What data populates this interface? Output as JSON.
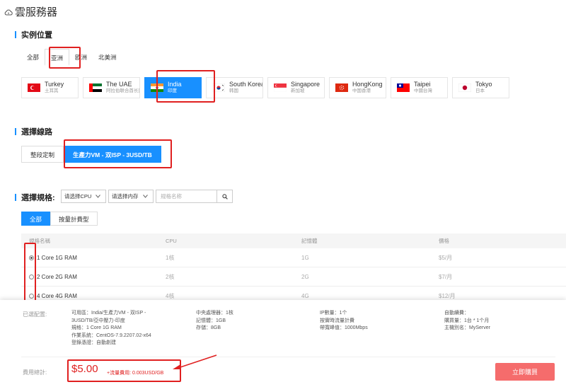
{
  "header": {
    "title": "雲服務器"
  },
  "sections": {
    "location": "实例位置",
    "line": "選擇線路",
    "spec": "選擇規格:"
  },
  "region_tabs": [
    "全部",
    "亚洲",
    "欧洲",
    "北美洲"
  ],
  "regions": [
    {
      "name": "Turkey",
      "sub": "土耳其"
    },
    {
      "name": "The UAE",
      "sub": "阿拉伯联合酋长国"
    },
    {
      "name": "India",
      "sub": "印度"
    },
    {
      "name": "South Korea",
      "sub": "韩国"
    },
    {
      "name": "Singapore",
      "sub": "新加坡"
    },
    {
      "name": "HongKong",
      "sub": "中国香港"
    },
    {
      "name": "Taipei",
      "sub": "中國台灣"
    },
    {
      "name": "Tokyo",
      "sub": "日本"
    }
  ],
  "line_tabs": [
    "整段定制",
    "生產力VM - 双ISP - 3USD/TB"
  ],
  "filters": {
    "cpu": "请选择CPU",
    "memory": "请选择内存",
    "search_placeholder": "规格名称"
  },
  "type_tabs": [
    "全部",
    "按量計費型"
  ],
  "table": {
    "headers": [
      "規格名稱",
      "CPU",
      "記憶體",
      "價格"
    ],
    "rows": [
      {
        "name": "1 Core 1G RAM",
        "cpu": "1核",
        "mem": "1G",
        "price": "$5/月"
      },
      {
        "name": "2 Core 2G RAM",
        "cpu": "2核",
        "mem": "2G",
        "price": "$7/月"
      },
      {
        "name": "4 Core 4G RAM",
        "cpu": "4核",
        "mem": "4G",
        "price": "$12/月"
      }
    ]
  },
  "footer": {
    "selected_label": "已選配置:",
    "col1": [
      "可用區：India/生產力VM - 双ISP -",
      "3USD/TB/亞中壓力-印度",
      "規格：1 Core 1G RAM",
      "作業系統：CentOS-7.9.2207.02-x64",
      "登錄憑證：自動創建"
    ],
    "col2": [
      "中央處理器：1核",
      "記憶體：1GB",
      "存儲：8GB"
    ],
    "col3": [
      "IP數量：1个",
      "按實時流量計費",
      "帶寬峰值：1000Mbps"
    ],
    "col4": [
      "自動續費：",
      "購買量：1台 * 1个月",
      "主機別名：MyServer"
    ],
    "fee_label": "費用總計:",
    "price": "$5.00",
    "extra": "+流量費用: 0.003USD/GB",
    "buy": "立即購買"
  },
  "colors": {
    "accent": "#1890ff",
    "highlight": "#e02020",
    "buy": "#f56c6c"
  }
}
